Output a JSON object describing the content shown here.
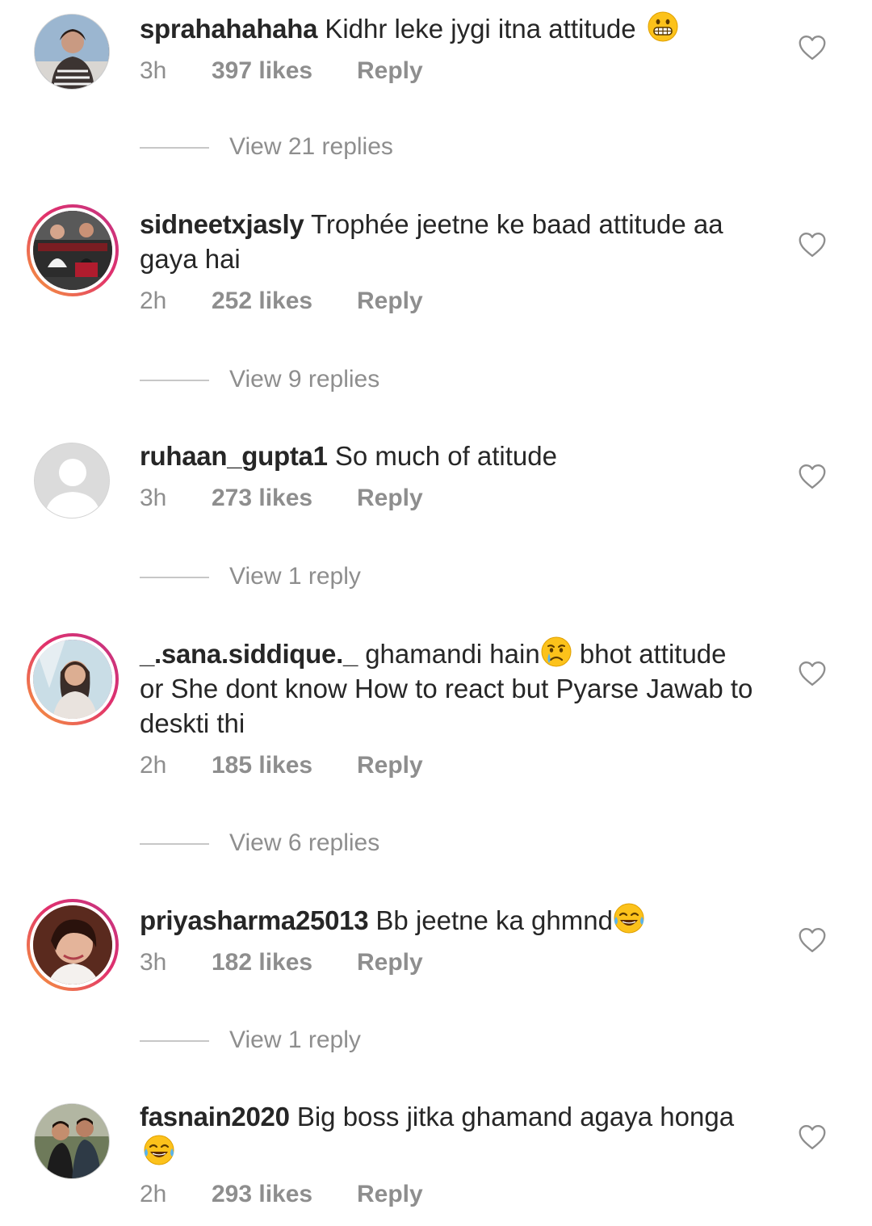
{
  "comments": [
    {
      "username": "sprahahahaha",
      "text": "Kidhr leke jygi itna attitude",
      "emoji": "grimacing",
      "time": "3h",
      "likes": "397 likes",
      "reply": "Reply",
      "view_replies": "View 21 replies"
    },
    {
      "username": "sidneetxjasly",
      "text": "Trophée jeetne ke baad attitude aa gaya hai",
      "time": "2h",
      "likes": "252 likes",
      "reply": "Reply",
      "view_replies": "View 9 replies"
    },
    {
      "username": "ruhaan_gupta1",
      "text": "So much of atitude",
      "time": "3h",
      "likes": "273 likes",
      "reply": "Reply",
      "view_replies": "View 1 reply"
    },
    {
      "username": "_.sana.siddique._",
      "text_before": "ghamandi hain",
      "emoji": "crying",
      "text": "bhot attitude or She dont know How to react but Pyarse Jawab to deskti thi",
      "time": "2h",
      "likes": "185 likes",
      "reply": "Reply",
      "view_replies": "View 6 replies"
    },
    {
      "username": "priyasharma25013",
      "text": "Bb jeetne ka ghmnd",
      "emoji": "tears-of-joy",
      "time": "3h",
      "likes": "182 likes",
      "reply": "Reply",
      "view_replies": "View 1 reply"
    },
    {
      "username": "fasnain2020",
      "text": "Big boss jitka ghamand agaya honga",
      "emoji": "tears-of-joy",
      "time": "2h",
      "likes": "293 likes",
      "reply": "Reply"
    }
  ],
  "colors": {
    "text": "#262626",
    "secondary": "#8e8e8e",
    "story_ring_start": "#f7a03a",
    "story_ring_end": "#c13584"
  }
}
